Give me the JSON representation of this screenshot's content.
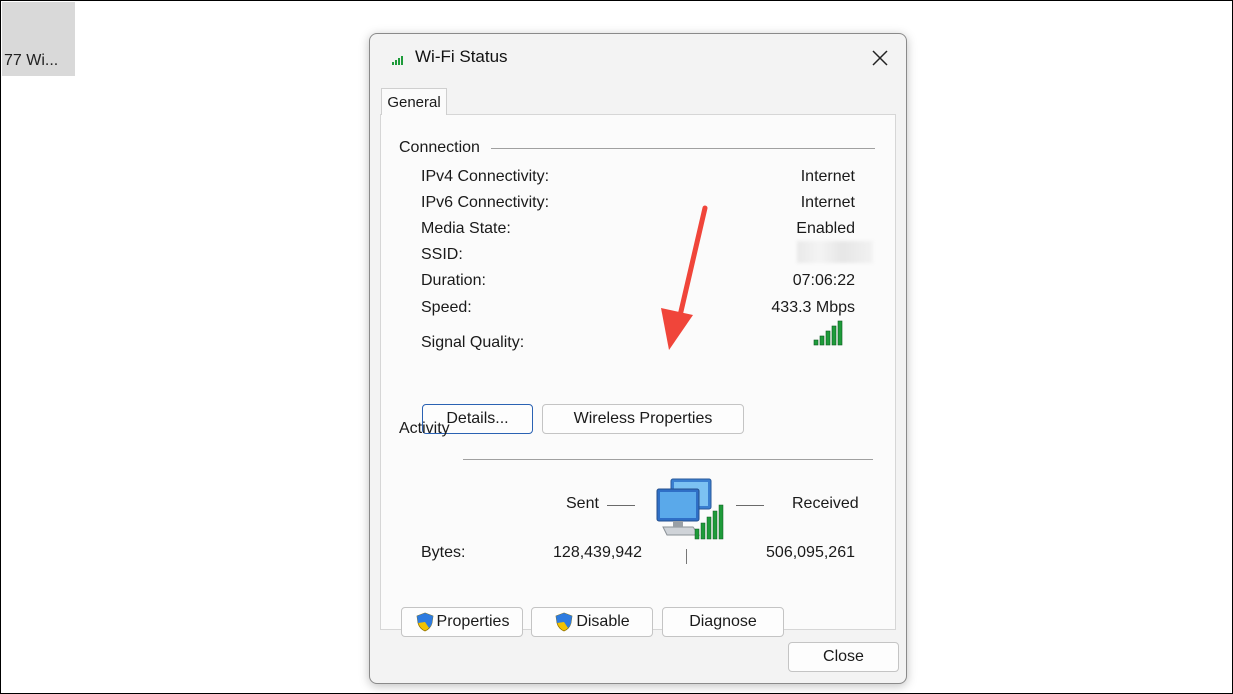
{
  "background": {
    "tab_label": "77 Wi..."
  },
  "dialog": {
    "title": "Wi-Fi Status",
    "tabs": [
      {
        "label": "General"
      }
    ],
    "connection": {
      "group_label": "Connection",
      "rows": [
        {
          "label": "IPv4 Connectivity:",
          "value": "Internet"
        },
        {
          "label": "IPv6 Connectivity:",
          "value": "Internet"
        },
        {
          "label": "Media State:",
          "value": "Enabled"
        },
        {
          "label": "SSID:",
          "value": ""
        },
        {
          "label": "Duration:",
          "value": "07:06:22"
        },
        {
          "label": "Speed:",
          "value": "433.3 Mbps"
        },
        {
          "label": "Signal Quality:",
          "value": ""
        }
      ],
      "signal_bars": 5,
      "details_label": "Details...",
      "wireless_properties_label": "Wireless Properties"
    },
    "activity": {
      "group_label": "Activity",
      "sent_label": "Sent",
      "received_label": "Received",
      "bytes_label": "Bytes:",
      "bytes_sent": "128,439,942",
      "bytes_received": "506,095,261"
    },
    "buttons": {
      "properties": "Properties",
      "disable": "Disable",
      "diagnose": "Diagnose",
      "close": "Close"
    }
  },
  "colors": {
    "signal_green": "#1e9b3a",
    "arrow_red": "#f0453a",
    "default_button_border": "#2a62b3"
  },
  "icons": [
    "wifi-signal-icon",
    "close-icon",
    "shield-icon",
    "network-computers-icon",
    "signal-quality-icon",
    "annotation-arrow"
  ]
}
